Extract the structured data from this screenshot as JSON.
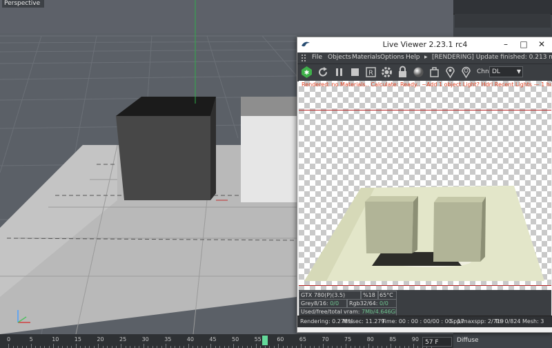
{
  "viewport": {
    "label": "Perspective"
  },
  "live_viewer": {
    "title": "Live Viewer 2.23.1 rc4",
    "window_controls": {
      "minimize": "–",
      "maximize": "□",
      "close": "✕"
    },
    "menu": [
      "File",
      "Objects",
      "Materials",
      "Options",
      "Help"
    ],
    "status_arrow": "▸",
    "status": "[RENDERING] Update finished: 0.213 ms.",
    "toolbar_icons": [
      "octane-logo-icon",
      "restart-icon",
      "pause-icon",
      "stop-icon",
      "region-icon",
      "settings-gear-icon",
      "lock-icon",
      "material-ball-icon",
      "clay-mode-icon",
      "pick-focus-icon",
      "pick-material-icon"
    ],
    "channel_label": "Chn:",
    "channel_value": "DL",
    "warning_text": "Rendered: no Materials.. Calculate: Ready.. ~Add 1 object Light? Hdrl Recent Lights — 1 hdri 0",
    "stats": {
      "gpu": "GTX 780(P)(3.5)",
      "gpu_usage": "%18",
      "gpu_temp": "65°C",
      "grey_label": "Grey8/16:",
      "grey_value": "0/0",
      "rgb_label": "Rgb32/64:",
      "rgb_value": "0/0",
      "vram_label": "Used/free/total vram:",
      "vram_value": "7Mb/4.646Gb/6Gb"
    },
    "bottom": {
      "rendering": "Rendering: 0.278%",
      "ms_sec": "Ms/sec: 11.279",
      "time": "Time: 00 : 00 : 00/00 : 00 : 17",
      "spp": "Spp/maxspp: 2/719",
      "tri": "Tri: 0/824",
      "mesh": "Mesh: 3"
    }
  },
  "timeline": {
    "ticks": [
      "0",
      "5",
      "10",
      "15",
      "20",
      "25",
      "30",
      "35",
      "40",
      "45",
      "50",
      "55",
      "60",
      "65",
      "70",
      "75",
      "80",
      "85",
      "90"
    ],
    "current_frame": 57,
    "frame_field": "57 F"
  },
  "right_panel": {
    "channel": "Diffuse"
  },
  "colors": {
    "ui_dark": "#3b3e42",
    "accent_green": "#63d99a",
    "warning": "#e04020",
    "render_line": "#b32020"
  }
}
